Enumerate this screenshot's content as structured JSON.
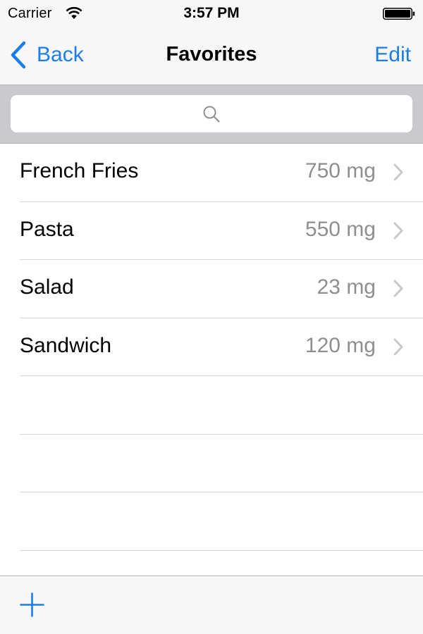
{
  "status_bar": {
    "carrier": "Carrier",
    "time": "3:57 PM"
  },
  "nav": {
    "back_label": "Back",
    "title": "Favorites",
    "edit_label": "Edit"
  },
  "search": {
    "placeholder": ""
  },
  "items": [
    {
      "name": "French Fries",
      "value": "750 mg"
    },
    {
      "name": "Pasta",
      "value": "550 mg"
    },
    {
      "name": "Salad",
      "value": "23 mg"
    },
    {
      "name": "Sandwich",
      "value": "120 mg"
    }
  ],
  "empty_rows": 4,
  "colors": {
    "accent": "#1a7ee6",
    "detail_text": "#8e8e93",
    "chevron": "#c7c7cc",
    "search_bar_bg": "#c9c9ce",
    "bar_bg": "#f7f7f7"
  },
  "icons": [
    "wifi-icon",
    "battery-icon",
    "chevron-left-icon",
    "search-icon",
    "chevron-right-icon",
    "plus-icon"
  ]
}
